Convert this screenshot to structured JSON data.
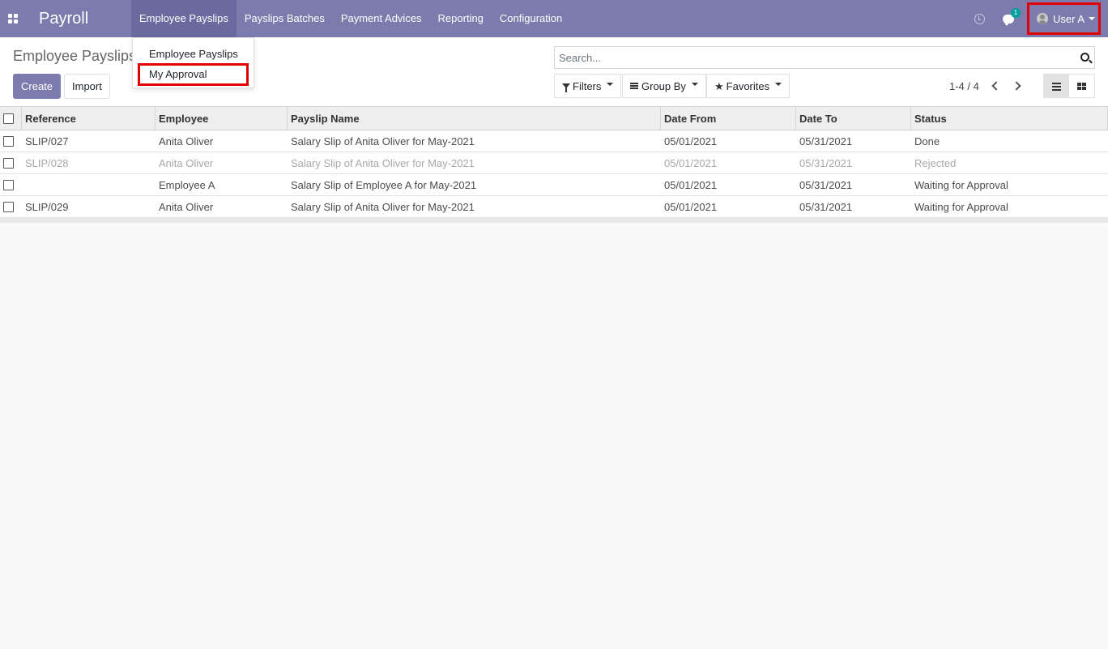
{
  "navbar": {
    "brand": "Payroll",
    "menu": [
      {
        "label": "Employee Payslips"
      },
      {
        "label": "Payslips Batches"
      },
      {
        "label": "Payment Advices"
      },
      {
        "label": "Reporting"
      },
      {
        "label": "Configuration"
      }
    ],
    "chat_badge": "1",
    "user_name": "User A",
    "accent_color": "#7c7bad"
  },
  "dropdown": {
    "items": [
      {
        "label": "Employee Payslips"
      },
      {
        "label": "My Approval"
      }
    ]
  },
  "control_panel": {
    "breadcrumb": "Employee Payslips",
    "create_label": "Create",
    "import_label": "Import",
    "search_placeholder": "Search...",
    "filters_label": "Filters",
    "group_by_label": "Group By",
    "favorites_label": "Favorites",
    "pager": "1-4 / 4"
  },
  "table": {
    "columns": [
      "Reference",
      "Employee",
      "Payslip Name",
      "Date From",
      "Date To",
      "Status"
    ],
    "rows": [
      {
        "reference": "SLIP/027",
        "employee": "Anita Oliver",
        "name": "Salary Slip of Anita Oliver for May-2021",
        "date_from": "05/01/2021",
        "date_to": "05/31/2021",
        "status": "Done"
      },
      {
        "reference": "SLIP/028",
        "employee": "Anita Oliver",
        "name": "Salary Slip of Anita Oliver for May-2021",
        "date_from": "05/01/2021",
        "date_to": "05/31/2021",
        "status": "Rejected"
      },
      {
        "reference": "",
        "employee": "Employee A",
        "name": "Salary Slip of Employee A for May-2021",
        "date_from": "05/01/2021",
        "date_to": "05/31/2021",
        "status": "Waiting for Approval"
      },
      {
        "reference": "SLIP/029",
        "employee": "Anita Oliver",
        "name": "Salary Slip of Anita Oliver for May-2021",
        "date_from": "05/01/2021",
        "date_to": "05/31/2021",
        "status": "Waiting for Approval"
      }
    ]
  },
  "annotation_color": "#e20000"
}
